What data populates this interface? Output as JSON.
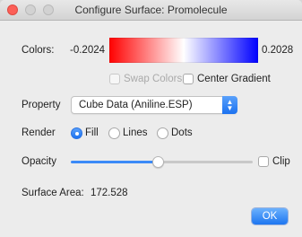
{
  "window": {
    "title": "Configure Surface: Promolecule"
  },
  "colors": {
    "label": "Colors:",
    "min_value": "-0.2024",
    "max_value": "0.2028",
    "gradient": [
      "#ff0000",
      "#ffffff",
      "#0000ff"
    ]
  },
  "options": {
    "swap_colors": {
      "label": "Swap Colors",
      "checked": false,
      "enabled": false
    },
    "center_gradient": {
      "label": "Center Gradient",
      "checked": false,
      "enabled": true
    }
  },
  "property": {
    "label": "Property",
    "selected": "Cube Data (Aniline.ESP)"
  },
  "render": {
    "label": "Render",
    "options": [
      "Fill",
      "Lines",
      "Dots"
    ],
    "selected": "Fill"
  },
  "opacity": {
    "label": "Opacity",
    "value_fraction": 0.45,
    "clip_label": "Clip",
    "clip_checked": false
  },
  "surface_area": {
    "label": "Surface Area:",
    "value": "172.528"
  },
  "buttons": {
    "ok": "OK"
  },
  "accent_color": "#1c72f0"
}
